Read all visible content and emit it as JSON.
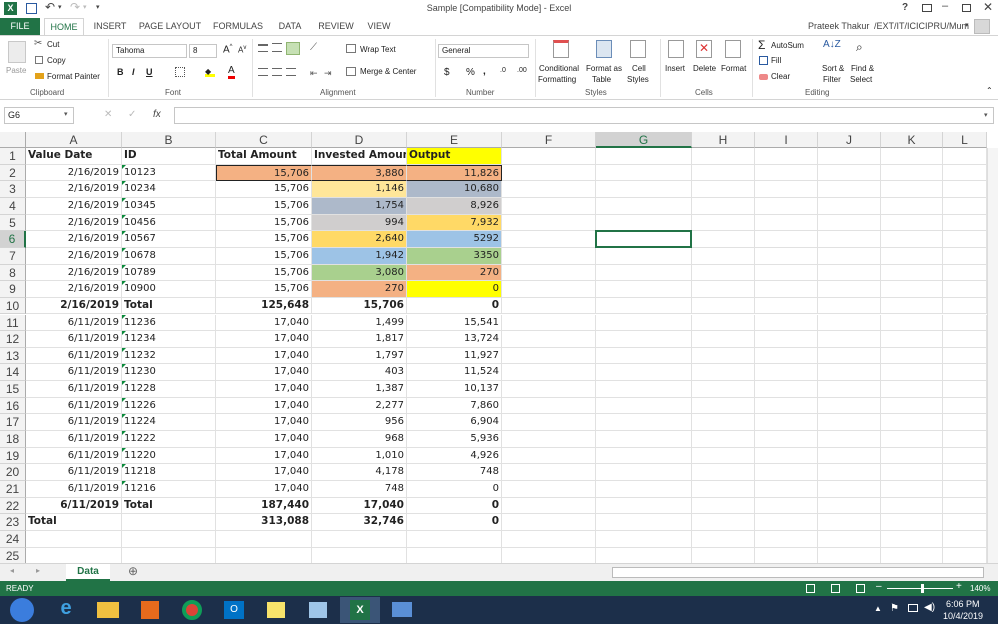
{
  "window": {
    "title": "Sample  [Compatibility Mode] - Excel",
    "help": "?",
    "user": "Prateek Thakur",
    "account_path": "/EXT/IT/ICICIPRU/Mum"
  },
  "tabs": [
    "FILE",
    "HOME",
    "INSERT",
    "PAGE LAYOUT",
    "FORMULAS",
    "DATA",
    "REVIEW",
    "VIEW"
  ],
  "ribbon": {
    "clipboard": {
      "paste": "Paste",
      "cut": "Cut",
      "copy": "Copy",
      "format_painter": "Format Painter",
      "label": "Clipboard"
    },
    "font": {
      "name": "Tahoma",
      "size": "8",
      "label": "Font"
    },
    "alignment": {
      "wrap": "Wrap Text",
      "merge": "Merge & Center",
      "label": "Alignment"
    },
    "number": {
      "format": "General",
      "label": "Number",
      "currency": "$",
      "percent": "%",
      "comma": ","
    },
    "styles": {
      "conditional": "Conditional",
      "conditional2": "Formatting",
      "format_as": "Format as",
      "format_as2": "Table",
      "cell": "Cell",
      "cell2": "Styles",
      "label": "Styles"
    },
    "cells": {
      "insert": "Insert",
      "delete": "Delete",
      "format": "Format",
      "label": "Cells"
    },
    "editing": {
      "autosum": "AutoSum",
      "fill": "Fill",
      "clear": "Clear",
      "sort": "Sort &",
      "sort2": "Filter",
      "find": "Find &",
      "find2": "Select",
      "label": "Editing"
    }
  },
  "formula_bar": {
    "name_box": "G6",
    "fx": "fx",
    "content": ""
  },
  "columns": [
    "A",
    "B",
    "C",
    "D",
    "E",
    "F",
    "G",
    "H",
    "I",
    "J",
    "K",
    "L"
  ],
  "rows": [
    {
      "n": "1",
      "a": "Value Date",
      "b": "ID",
      "c": "Total Amount",
      "d": "Invested Amount",
      "e": "Output",
      "hdr": true
    },
    {
      "n": "2",
      "a": "2/16/2019",
      "b": "10123",
      "c": "15,706",
      "d": "3,880",
      "e": "11,826"
    },
    {
      "n": "3",
      "a": "2/16/2019",
      "b": "10234",
      "c": "15,706",
      "d": "1,146",
      "e": "10,680"
    },
    {
      "n": "4",
      "a": "2/16/2019",
      "b": "10345",
      "c": "15,706",
      "d": "1,754",
      "e": "8,926"
    },
    {
      "n": "5",
      "a": "2/16/2019",
      "b": "10456",
      "c": "15,706",
      "d": "994",
      "e": "7,932"
    },
    {
      "n": "6",
      "a": "2/16/2019",
      "b": "10567",
      "c": "15,706",
      "d": "2,640",
      "e": "5292"
    },
    {
      "n": "7",
      "a": "2/16/2019",
      "b": "10678",
      "c": "15,706",
      "d": "1,942",
      "e": "3350"
    },
    {
      "n": "8",
      "a": "2/16/2019",
      "b": "10789",
      "c": "15,706",
      "d": "3,080",
      "e": "270"
    },
    {
      "n": "9",
      "a": "2/16/2019",
      "b": "10900",
      "c": "15,706",
      "d": "270",
      "e": "0"
    },
    {
      "n": "10",
      "a": "2/16/2019",
      "b": "Total",
      "c": "125,648",
      "d": "15,706",
      "e": "0",
      "bold": true
    },
    {
      "n": "11",
      "a": "6/11/2019",
      "b": "11236",
      "c": "17,040",
      "d": "1,499",
      "e": "15,541"
    },
    {
      "n": "12",
      "a": "6/11/2019",
      "b": "11234",
      "c": "17,040",
      "d": "1,817",
      "e": "13,724"
    },
    {
      "n": "13",
      "a": "6/11/2019",
      "b": "11232",
      "c": "17,040",
      "d": "1,797",
      "e": "11,927"
    },
    {
      "n": "14",
      "a": "6/11/2019",
      "b": "11230",
      "c": "17,040",
      "d": "403",
      "e": "11,524"
    },
    {
      "n": "15",
      "a": "6/11/2019",
      "b": "11228",
      "c": "17,040",
      "d": "1,387",
      "e": "10,137"
    },
    {
      "n": "16",
      "a": "6/11/2019",
      "b": "11226",
      "c": "17,040",
      "d": "2,277",
      "e": "7,860"
    },
    {
      "n": "17",
      "a": "6/11/2019",
      "b": "11224",
      "c": "17,040",
      "d": "956",
      "e": "6,904"
    },
    {
      "n": "18",
      "a": "6/11/2019",
      "b": "11222",
      "c": "17,040",
      "d": "968",
      "e": "5,936"
    },
    {
      "n": "19",
      "a": "6/11/2019",
      "b": "11220",
      "c": "17,040",
      "d": "1,010",
      "e": "4,926"
    },
    {
      "n": "20",
      "a": "6/11/2019",
      "b": "11218",
      "c": "17,040",
      "d": "4,178",
      "e": "748"
    },
    {
      "n": "21",
      "a": "6/11/2019",
      "b": "11216",
      "c": "17,040",
      "d": "748",
      "e": "0"
    },
    {
      "n": "22",
      "a": "6/11/2019",
      "b": "Total",
      "c": "187,440",
      "d": "17,040",
      "e": "0",
      "bold": true
    },
    {
      "n": "23",
      "a": "Total",
      "b": "",
      "c": "313,088",
      "d": "32,746",
      "e": "0",
      "bold": true
    },
    {
      "n": "24",
      "a": "",
      "b": "",
      "c": "",
      "d": "",
      "e": ""
    },
    {
      "n": "25",
      "a": "",
      "b": "",
      "c": "",
      "d": "",
      "e": ""
    }
  ],
  "colors": {
    "excel_green": "#217346",
    "header_yellow": "#ffff00",
    "fill_salmon": "#f4b183",
    "fill_lightyellow": "#ffe699",
    "fill_slate": "#adb9ca",
    "fill_gray": "#d0cece",
    "fill_gold": "#ffd966",
    "fill_blue": "#9dc3e6",
    "fill_green": "#a9d08e"
  },
  "sheet": {
    "tab": "Data",
    "add": "⊕"
  },
  "status": {
    "ready": "READY",
    "zoom": "140%"
  },
  "taskbar": {
    "time": "6:06 PM",
    "date": "10/4/2019"
  }
}
